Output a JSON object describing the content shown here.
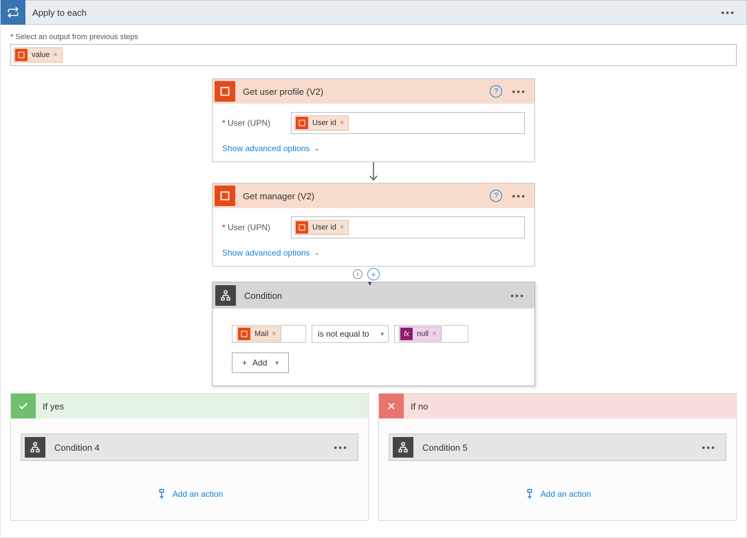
{
  "header": {
    "title": "Apply to each"
  },
  "output_label": "Select an output from previous steps",
  "output_token": "value",
  "steps": [
    {
      "title": "Get user profile (V2)",
      "field_label": "User (UPN)",
      "token": "User id",
      "advanced": "Show advanced options"
    },
    {
      "title": "Get manager (V2)",
      "field_label": "User (UPN)",
      "token": "User id",
      "advanced": "Show advanced options"
    }
  ],
  "condition": {
    "title": "Condition",
    "left_token": "Mail",
    "operator": "is not equal to",
    "right_fx": "null",
    "add_label": "Add"
  },
  "branches": {
    "yes": {
      "label": "If yes",
      "subcard": "Condition 4",
      "add": "Add an action"
    },
    "no": {
      "label": "If no",
      "subcard": "Condition 5",
      "add": "Add an action"
    }
  }
}
